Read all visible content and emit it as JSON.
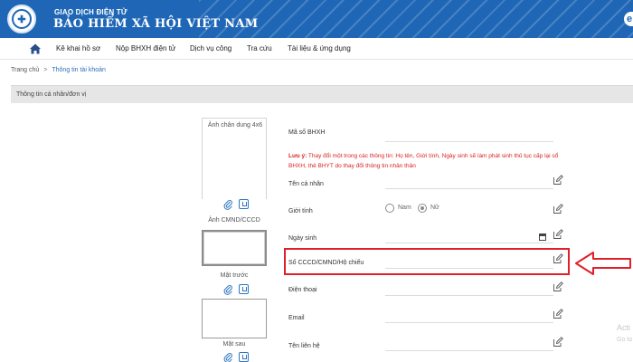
{
  "header": {
    "subtitle": "GIAO DỊCH ĐIỆN TỬ",
    "title": "BẢO HIỂM XÃ HỘI VIỆT NAM",
    "right_badge": "e"
  },
  "nav": {
    "items": [
      {
        "label": "Kê khai hồ sơ"
      },
      {
        "label": "Nộp BHXH điện tử"
      },
      {
        "label": "Dịch vụ công"
      },
      {
        "label": "Tra cứu"
      },
      {
        "label": "Tài liệu & ứng dụng"
      }
    ]
  },
  "breadcrumb": {
    "home": "Trang chủ",
    "separator": ">",
    "current": "Thông tin tài khoản"
  },
  "section": {
    "title": "Thông tin cá nhân/đơn vị"
  },
  "photos": {
    "portrait_label": "Ảnh chân dung 4x6",
    "id_label": "Ảnh CMND/CCCD",
    "front_label": "Mặt trước",
    "back_label": "Mặt sau"
  },
  "form": {
    "bhxh_label": "Mã số BHXH",
    "note_prefix": "Lưu ý:",
    "note_text": " Thay đổi một trong các thông tin: Họ tên, Giới tính, Ngày sinh sẽ làm phát sinh thủ tục cấp lại sổ BHXH, thẻ BHYT do thay đổi thông tin nhân thân",
    "name_label": "Tên cá nhân",
    "gender_label": "Giới tính",
    "gender_options": [
      "Nam",
      "Nữ"
    ],
    "gender_selected": "Nữ",
    "dob_label": "Ngày sinh",
    "id_label": "Số CCCD/CMND/Hộ chiếu",
    "phone_label": "Điện thoại",
    "email_label": "Email",
    "contact_label": "Tên liên hệ"
  },
  "watermark": {
    "line1": "Acti",
    "line2": "Go to"
  },
  "colors": {
    "header_blue": "#1f67b6",
    "note_red": "#d9231f",
    "highlight_red": "#e01f2a"
  }
}
